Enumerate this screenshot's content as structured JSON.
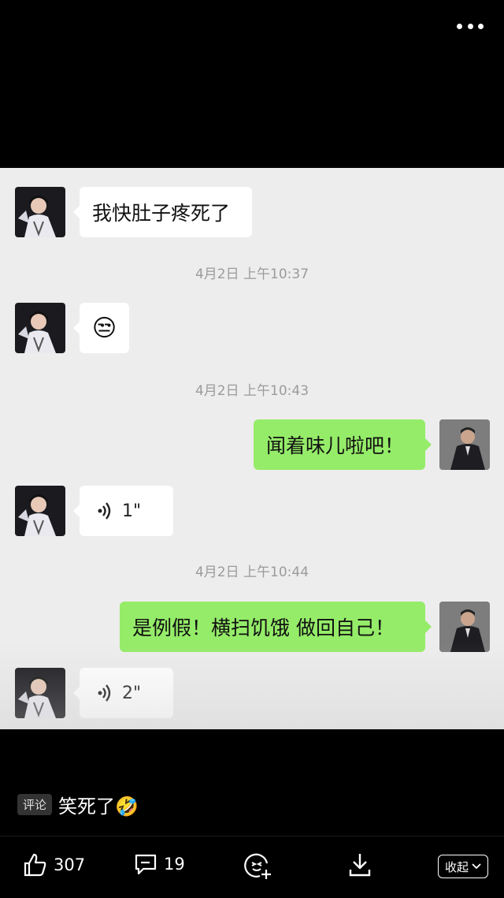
{
  "header": {
    "more_icon": "more-dots-icon"
  },
  "chat": {
    "messages": [
      {
        "side": "in",
        "type": "text",
        "text": "我快肚子疼死了"
      },
      {
        "type": "timestamp",
        "text": "4月2日 上午10:37"
      },
      {
        "side": "in",
        "type": "emoji",
        "text": "😒"
      },
      {
        "type": "timestamp",
        "text": "4月2日 上午10:43"
      },
      {
        "side": "out",
        "type": "text",
        "text": "闻着味儿啦吧！"
      },
      {
        "side": "in",
        "type": "voice",
        "text": "1\""
      },
      {
        "type": "timestamp",
        "text": "4月2日 上午10:44"
      },
      {
        "side": "out",
        "type": "text",
        "text": "是例假！横扫饥饿 做回自己！"
      },
      {
        "side": "in",
        "type": "voice",
        "text": "2\""
      }
    ]
  },
  "comment": {
    "tag": "评论",
    "text": "笑死了🤣"
  },
  "actions": {
    "like_count": "307",
    "comment_count": "19",
    "collapse_label": "收起"
  },
  "colors": {
    "incoming_bubble": "#ffffff",
    "outgoing_bubble": "#95ec69",
    "chat_bg": "#ededed"
  }
}
